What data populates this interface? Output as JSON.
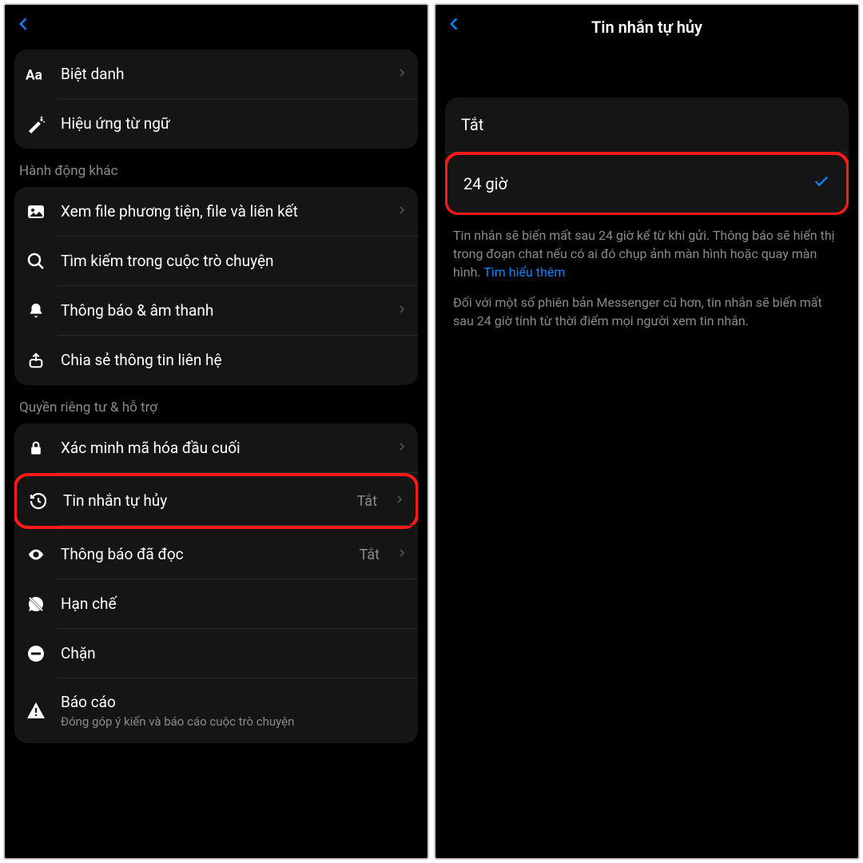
{
  "left": {
    "group1": {
      "nickname": "Biệt danh",
      "wordEffects": "Hiệu ứng từ ngữ"
    },
    "otherActionsTitle": "Hành động khác",
    "otherActions": {
      "media": "Xem file phương tiện, file và liên kết",
      "search": "Tìm kiếm trong cuộc trò chuyện",
      "notif": "Thông báo & âm thanh",
      "share": "Chia sẻ thông tin liên hệ"
    },
    "privacyTitle": "Quyền riêng tư & hỗ trợ",
    "privacy": {
      "verify": "Xác minh mã hóa đầu cuối",
      "disappear": "Tin nhắn tự hủy",
      "disappearValue": "Tắt",
      "readReceipts": "Thông báo đã đọc",
      "readValue": "Tắt",
      "restrict": "Hạn chế",
      "block": "Chặn",
      "report": "Báo cáo",
      "reportSub": "Đóng góp ý kiến và báo cáo cuộc trò chuyện"
    }
  },
  "right": {
    "title": "Tin nhắn tự hủy",
    "opts": {
      "off": "Tắt",
      "h24": "24 giờ"
    },
    "desc1": "Tin nhắn sẽ biến mất sau 24 giờ kể từ khi gửi. Thông báo sẽ hiển thị trong đoạn chat nếu có ai đó chụp ảnh màn hình hoặc quay màn hình.",
    "learnMore": "Tìm hiểu thêm",
    "desc2": "Đối với một số phiên bản Messenger cũ hơn, tin nhắn sẽ biến mất sau 24 giờ tính từ thời điểm mọi người xem tin nhắn."
  }
}
